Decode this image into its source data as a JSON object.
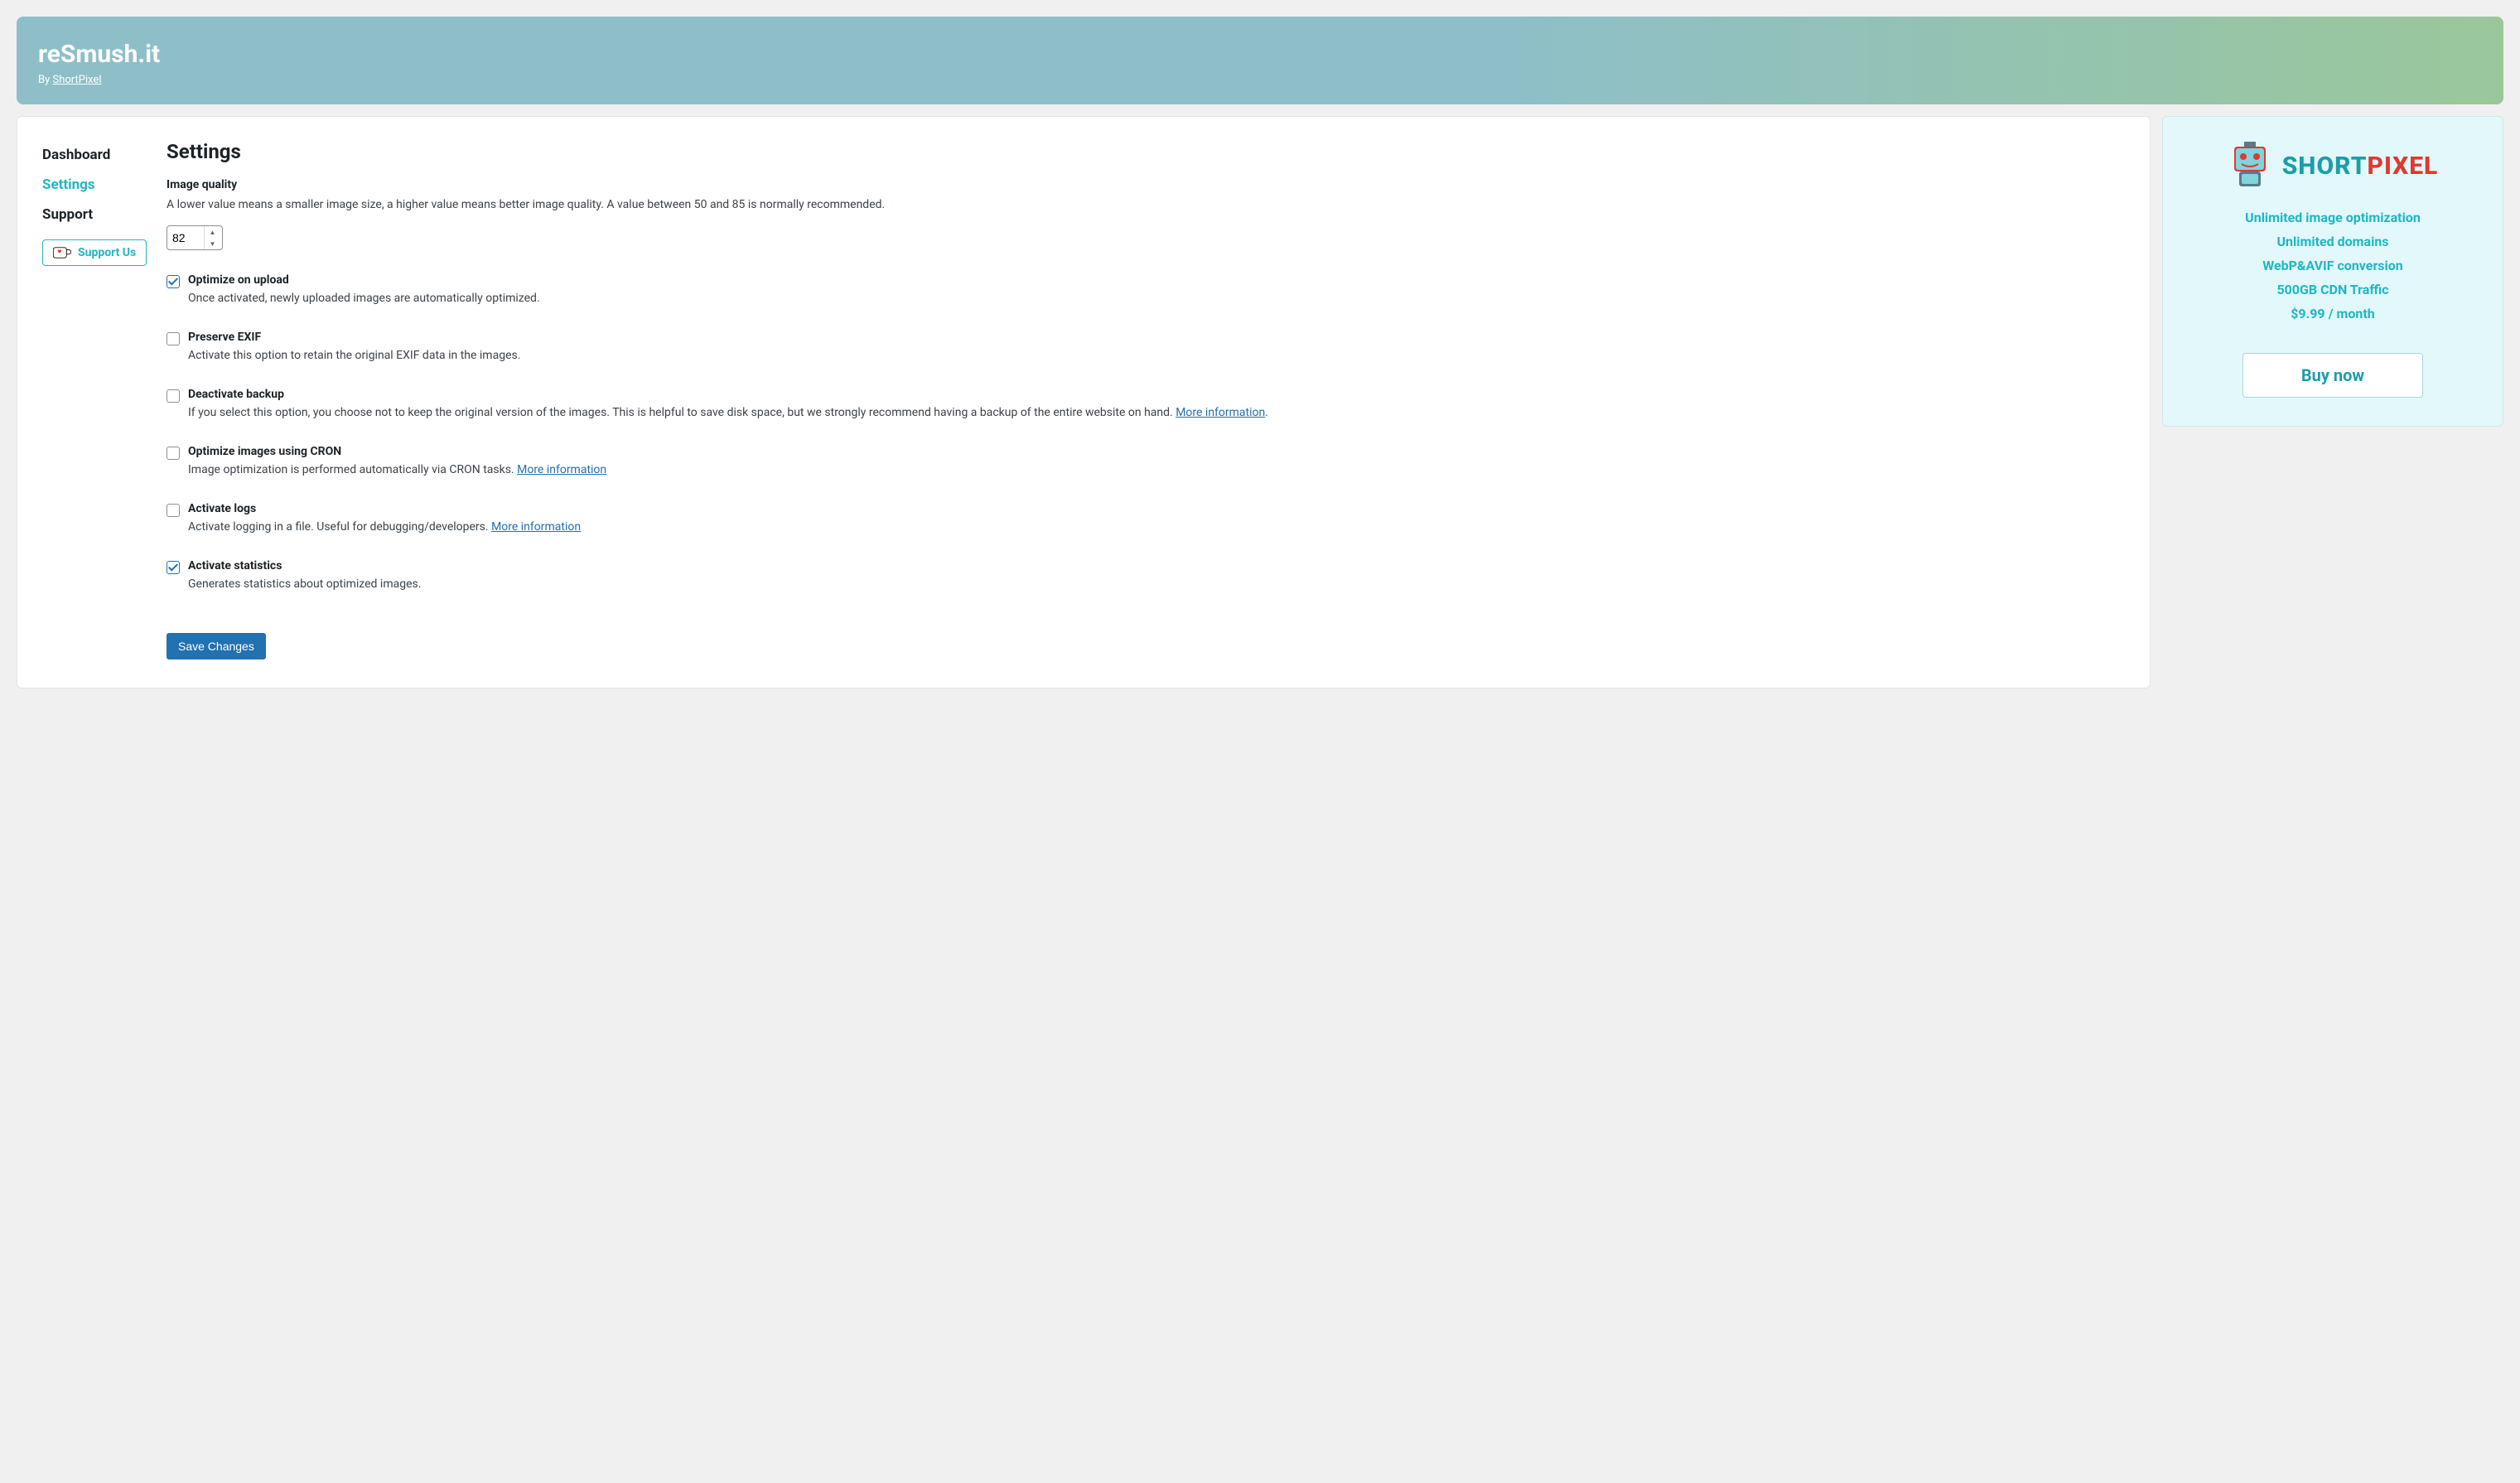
{
  "header": {
    "title": "reSmush.it",
    "byline_prefix": "By ",
    "byline_link": "ShortPixel"
  },
  "nav": {
    "dashboard": "Dashboard",
    "settings": "Settings",
    "support": "Support",
    "support_us": "Support Us"
  },
  "content": {
    "page_title": "Settings",
    "quality_label": "Image quality",
    "quality_desc": "A lower value means a smaller image size, a higher value means better image quality. A value between 50 and 85 is normally recommended.",
    "quality_value": "82",
    "options": [
      {
        "title": "Optimize on upload",
        "desc": "Once activated, newly uploaded images are automatically optimized.",
        "checked": true,
        "link": null
      },
      {
        "title": "Preserve EXIF",
        "desc": "Activate this option to retain the original EXIF data in the images.",
        "checked": false,
        "link": null
      },
      {
        "title": "Deactivate backup",
        "desc": "If you select this option, you choose not to keep the original version of the images. This is helpful to save disk space, but we strongly recommend having a backup of the entire website on hand. ",
        "checked": false,
        "link": "More information"
      },
      {
        "title": "Optimize images using CRON",
        "desc": "Image optimization is performed automatically via CRON tasks. ",
        "checked": false,
        "link": "More information"
      },
      {
        "title": "Activate logs",
        "desc": "Activate logging in a file. Useful for debugging/developers. ",
        "checked": false,
        "link": "More information"
      },
      {
        "title": "Activate statistics",
        "desc": "Generates statistics about optimized images.",
        "checked": true,
        "link": null
      }
    ],
    "save_label": "Save Changes"
  },
  "promo": {
    "brand_short": "SHORT",
    "brand_pixel": "PIXEL",
    "features": [
      "Unlimited image optimization",
      "Unlimited domains",
      "WebP&AVIF conversion",
      "500GB CDN Traffic",
      "$9.99 / month"
    ],
    "buy_label": "Buy now"
  },
  "more_info_suffix": "."
}
